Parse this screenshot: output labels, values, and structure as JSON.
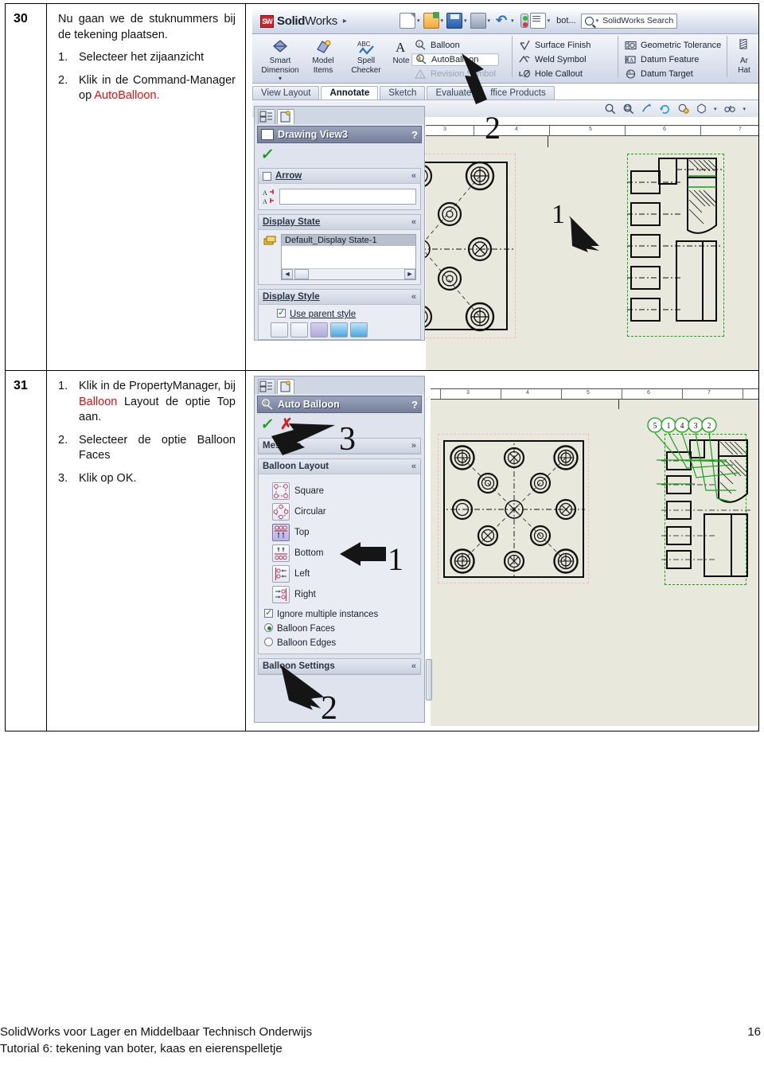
{
  "document": {
    "footer": {
      "line1": "SolidWorks voor Lager en Middelbaar Technisch Onderwijs",
      "line2": "Tutorial 6: tekening van boter, kaas en eierenspelletje",
      "page_number": "16"
    }
  },
  "rows": [
    {
      "number": "30",
      "intro": "Nu gaan we de stuknummers bij de tekening plaatsen.",
      "steps": [
        {
          "n": "1.",
          "pre": "Selecteer het zijaanzicht",
          "hl": "",
          "post": ""
        },
        {
          "n": "2.",
          "pre": "Klik in de Command-Manager op ",
          "hl": "AutoBalloon",
          "post": "."
        }
      ]
    },
    {
      "number": "31",
      "intro": "",
      "steps": [
        {
          "n": "1.",
          "pre": "Klik in de PropertyManager, bij ",
          "hl": "Balloon",
          "post": " Layout de optie Top aan."
        },
        {
          "n": "2.",
          "pre": "Selecteer de optie Balloon Faces",
          "hl": "",
          "post": ""
        },
        {
          "n": "3.",
          "pre": "Klik op OK.",
          "hl": "",
          "post": ""
        }
      ]
    }
  ],
  "solidworks": {
    "titlebar": {
      "logo_mark": "SW",
      "brand_bold": "Solid",
      "brand_light": "Works",
      "brand_caret": "▸",
      "quick_icons": [
        "new-document-icon",
        "open-folder-icon",
        "save-icon",
        "print-icon",
        "undo-icon",
        "rebuild-icon",
        "options-icon"
      ],
      "doc_name": "bot...",
      "search_placeholder": "SolidWorks Search",
      "search_caret": "▾"
    },
    "ribbon": {
      "big_buttons": [
        {
          "label_top": "Smart",
          "label_bottom": "Dimension",
          "icon": "smart-dimension-icon",
          "has_caret": true
        },
        {
          "label_top": "Model",
          "label_bottom": "Items",
          "icon": "model-items-icon",
          "has_caret": false
        },
        {
          "label_top": "Spell",
          "label_bottom": "Checker",
          "icon": "spell-checker-icon",
          "has_caret": false
        },
        {
          "label_top": "Note",
          "label_bottom": "",
          "icon": "note-icon",
          "has_caret": false
        }
      ],
      "column1": [
        {
          "label": "Balloon",
          "icon": "balloon-icon",
          "state": "normal"
        },
        {
          "label": "AutoBalloon",
          "icon": "autoballoon-icon",
          "state": "highlighted"
        },
        {
          "label": "Revision Symbol",
          "icon": "revision-symbol-icon",
          "state": "disabled"
        }
      ],
      "column2": [
        {
          "label": "Surface Finish",
          "icon": "surface-finish-icon"
        },
        {
          "label": "Weld Symbol",
          "icon": "weld-symbol-icon"
        },
        {
          "label": "Hole Callout",
          "icon": "hole-callout-icon"
        }
      ],
      "column3": [
        {
          "label": "Geometric Tolerance",
          "icon": "geometric-tolerance-icon"
        },
        {
          "label": "Datum Feature",
          "icon": "datum-feature-icon"
        },
        {
          "label": "Datum Target",
          "icon": "datum-target-icon"
        }
      ],
      "column4": {
        "label_top": "Ar",
        "label_bottom": "Hat",
        "icon": "area-hatch-icon"
      }
    },
    "tabs": [
      {
        "label": "View Layout",
        "active": false
      },
      {
        "label": "Annotate",
        "active": true
      },
      {
        "label": "Sketch",
        "active": false
      },
      {
        "label": "Evaluate",
        "active": false
      },
      {
        "label": "ffice Products",
        "active": false
      }
    ],
    "statusbar_icons": [
      "zoom-in-icon",
      "zoom-area-icon",
      "pan-icon",
      "rebuild-icon",
      "section-icon",
      "view-orientation-icon",
      "display-style-icon"
    ]
  },
  "panel_drawing_view": {
    "tabs": [
      "feature-manager-tab",
      "property-manager-tab"
    ],
    "header": {
      "icon": "drawing-view-icon",
      "title": "Drawing View3",
      "help": "?"
    },
    "ok_icon": "green-check-icon",
    "sections": [
      {
        "title": "Arrow",
        "checkbox": false,
        "chevron": "«",
        "field_icons": [
          "text-align-icon-1",
          "text-align-icon-2"
        ],
        "field_value": ""
      },
      {
        "title": "Display State",
        "chevron": "«",
        "icon": "display-state-icon",
        "list_selected": "Default_Display State-1",
        "scroll_left": "◄",
        "scroll_right": "►"
      },
      {
        "title": "Display Style",
        "chevron": "«",
        "checkbox_label": "Use parent style",
        "checkbox_checked": true,
        "style_buttons": [
          "wireframe-icon",
          "hidden-lines-visible-icon",
          "hidden-lines-removed-icon",
          "shaded-with-edges-icon",
          "shaded-icon"
        ]
      }
    ]
  },
  "panel_auto_balloon": {
    "tabs": [
      "feature-manager-tab",
      "property-manager-tab"
    ],
    "header": {
      "icon": "autoballoon-icon",
      "title": "Auto Balloon",
      "help": "?"
    },
    "ok_icon": "green-check-icon",
    "cancel_icon": "red-x-icon",
    "sections": [
      {
        "title": "Message",
        "chevron": "»"
      },
      {
        "title": "Balloon Layout",
        "chevron": "«"
      },
      {
        "title": "Balloon Settings",
        "chevron": "«"
      }
    ],
    "layout_options": [
      {
        "label": "Square",
        "icon": "layout-square-icon",
        "selected": false
      },
      {
        "label": "Circular",
        "icon": "layout-circular-icon",
        "selected": false
      },
      {
        "label": "Top",
        "icon": "layout-top-icon",
        "selected": true
      },
      {
        "label": "Bottom",
        "icon": "layout-bottom-icon",
        "selected": false
      },
      {
        "label": "Left",
        "icon": "layout-left-icon",
        "selected": false
      },
      {
        "label": "Right",
        "icon": "layout-right-icon",
        "selected": false
      }
    ],
    "checkbox": {
      "label": "Ignore multiple instances",
      "checked": true
    },
    "radios": [
      {
        "label": "Balloon Faces",
        "selected": true
      },
      {
        "label": "Balloon Edges",
        "selected": false
      }
    ]
  },
  "annotations": {
    "row30": [
      {
        "text": "1",
        "meaning": "select-side-view-callout"
      },
      {
        "text": "2",
        "meaning": "click-autoballoon-callout"
      }
    ],
    "row31": [
      {
        "text": "1",
        "meaning": "choose-top-layout-callout"
      },
      {
        "text": "2",
        "meaning": "choose-balloon-faces-callout"
      },
      {
        "text": "3",
        "meaning": "click-ok-callout"
      }
    ]
  },
  "drawing": {
    "balloon_labels": [
      "5",
      "1",
      "4",
      "3",
      "2"
    ],
    "background": "#e8e8dc",
    "selection_green": "#1aa11a",
    "viewbox_pink": "#f0b9cf"
  },
  "colors": {
    "highlight_red": "#e01010",
    "sheet_bg": "#e8e8dc",
    "pm_header": "#767f9b"
  }
}
